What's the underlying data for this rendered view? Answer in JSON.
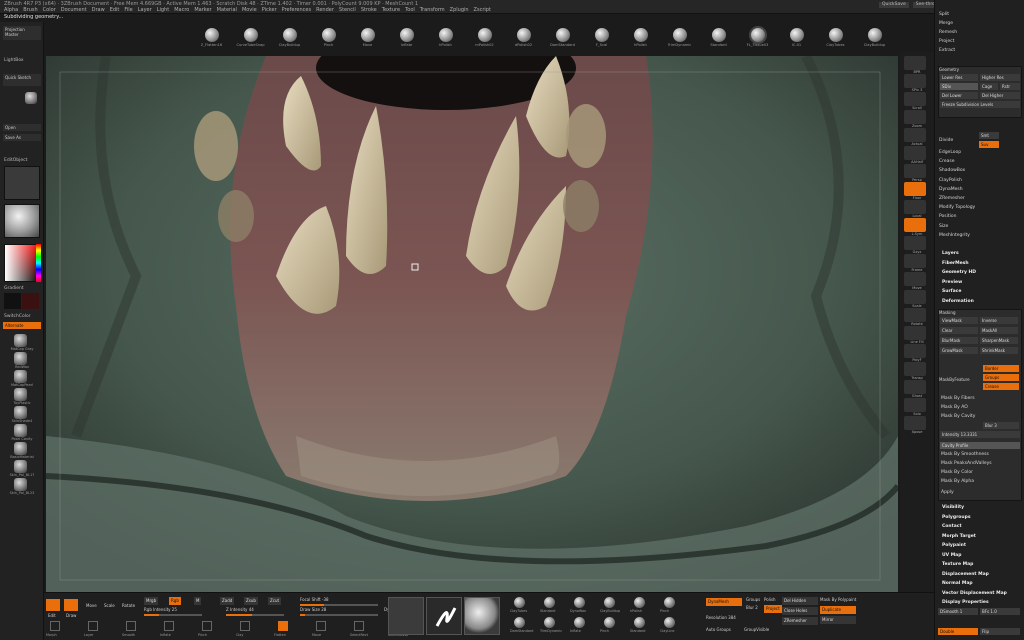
{
  "app": {
    "title": "ZBrush 4R7 P3 (x64) · 3ZBrush Document · Free Mem 4.669GB · Active Mem 1.463 · Scratch Disk 48 · ZTime 1.402 · Timer 0.001 · PolyCount 9.009 KP · MeshCount 1",
    "menus": [
      "Alpha",
      "Brush",
      "Color",
      "Document",
      "Draw",
      "Edit",
      "File",
      "Layer",
      "Light",
      "Macro",
      "Marker",
      "Material",
      "Movie",
      "Picker",
      "Preferences",
      "Render",
      "Stencil",
      "Stroke",
      "Texture",
      "Tool",
      "Transform",
      "Zplugin",
      "Zscript"
    ],
    "quicksave": "QuickSave",
    "see_through": "See-through 0",
    "menus_btn": "Menus",
    "default_script": "DefaultZScript"
  },
  "status": {
    "message": "Subdividing geometry..."
  },
  "colors": {
    "accent": "#e86f0c",
    "panel": "#222222",
    "canvas_bg": "#3b4b43"
  },
  "shelf": {
    "brushes": [
      "Z_Flatten16",
      "CurveTubeSnap",
      "ClayBuildup",
      "Pinch",
      "Move",
      "Inflate",
      "hPolish",
      "mPolish02",
      "dPolish02",
      "DamStandard",
      "F_Scal",
      "hPolish",
      "TrimDynamic",
      "Standard",
      "FL_Tissue03",
      "IC-01",
      "ClayTubes",
      "ClayBuildup"
    ],
    "selected_index": 14
  },
  "left": {
    "projection_master": "Projection Master",
    "lightbox": "LightBox",
    "quick_sketch": "Quick Sketch",
    "stereo_label": "Stereo",
    "open": "Open",
    "save_as": "Save As",
    "editobject": "EditObject",
    "gradient": "Gradient",
    "switch_color": "SwitchColor",
    "alternate": "Alternate",
    "tools": [
      "MatCap Gray",
      "RedWax",
      "MatCapPearl",
      "ToyPlastic",
      "SkinShade4",
      "Pearl Cavity",
      "BasicMaterial",
      "Skin_Pal_BL17",
      "Skin_Pal_BL23"
    ]
  },
  "right_icons": [
    "BPR",
    "SPix 3",
    "Scroll",
    "Zoom",
    "Actual",
    "AAHalf",
    "Persp",
    "Floor",
    "Local",
    "L.Sym",
    "Gxyz",
    "Frame",
    "Move",
    "Scale",
    "Rotate",
    "Line Fill",
    "PolyF",
    "Transp",
    "Ghost",
    "Solo",
    "Xpose"
  ],
  "right": {
    "top_items": [
      "Split",
      "Merge",
      "Remesh",
      "Project",
      "Extract"
    ],
    "geometry_header": "Geometry",
    "lower_res": "Lower Res",
    "higher_res": "Higher Res",
    "sdiv_label": "SDiv",
    "cage": "Cage",
    "rstr": "Rstr",
    "del_lower": "Del Lower",
    "del_higher": "Del Higher",
    "freeze_subdivision": "Freeze Subdivision Levels",
    "divide": "Divide",
    "smt": "Smt",
    "suv": "Suv",
    "geo_items": [
      "EdgeLoop",
      "Crease",
      "ShadowBox",
      "ClayPolish",
      "DynaMesh",
      "ZRemesher",
      "Modify Topology",
      "Position",
      "Size",
      "MeshIntegrity"
    ],
    "sub_menus": [
      "Layers",
      "FiberMesh",
      "Geometry HD",
      "Preview",
      "Surface",
      "Deformation"
    ],
    "masking_header": "Masking",
    "mask_buttons": [
      "ViewMask",
      "Inverse",
      "Clear",
      "MaskAll",
      "BlurMask",
      "SharpenMask",
      "GrowMask",
      "ShrinkMask"
    ],
    "mask_peaks": "MaskByFeature",
    "mask_feature_opts": [
      "Border",
      "Groups",
      "Crease"
    ],
    "mask_items": [
      "Mask By Fibers",
      "Mask By AO",
      "Mask By Cavity",
      "Mask By Smoothness",
      "Mask PeaksAndValleys",
      "Mask By Color",
      "Mask By Alpha",
      "Apply"
    ],
    "mask_by_cavity_label": "Mask By Cavity",
    "blur_label": "Blur 3",
    "intensity_label": "Intensity 13.3331",
    "cavity_profile": "Cavity Profile",
    "bottom_menus": [
      "Visibility",
      "Polygroups",
      "Contact",
      "Morph Target",
      "Polypaint",
      "UV Map",
      "Texture Map",
      "Displacement Map",
      "Normal Map",
      "Vector Displacement Map",
      "Display Properties"
    ],
    "dsmooth": "DSmooth 1",
    "bfs": "BFs 1.0",
    "double": "Double",
    "flip": "Flip"
  },
  "bottom": {
    "edit": "Edit",
    "draw": "Draw",
    "move": "Move",
    "scale": "Scale",
    "rotate": "Rotate",
    "mrgb": "Mrgb",
    "rgb": "Rgb",
    "m": "M",
    "zadd": "Zadd",
    "zsub": "Zsub",
    "zcut": "Zcut",
    "rgb_intensity": "Rgb Intensity 25",
    "z_intensity": "Z Intensity 44",
    "focal_shift": "Focal Shift -38",
    "draw_size": "Draw Size 28",
    "dynamic": "Dynamic",
    "brush_tools": [
      "Morph",
      "Layer",
      "Smooth",
      "Inflate",
      "Pinch",
      "Clay",
      "Flatten",
      "Move",
      "SelectRect",
      "SelectLasso"
    ],
    "brush_tool_states": [
      "off",
      "off",
      "off",
      "off",
      "off",
      "off",
      "on",
      "off",
      "off",
      "off"
    ],
    "texture_balls": [
      "ClayTubes",
      "Standard",
      "DynaWax",
      "ClayBuildup",
      "hPolish",
      "Pinch",
      "DamStandard",
      "TrimDynamic",
      "Inflate",
      "Pinch",
      "Standard",
      "ClayLine"
    ],
    "dynamesh": "DynaMesh",
    "groups": "Groups",
    "polish": "Polish",
    "blur": "Blur 2",
    "project": "Project",
    "resolution": "Resolution 384",
    "auto_groups": "Auto Groups",
    "group_visible": "GroupVisible",
    "del_hidden": "Del Hidden",
    "close_holes": "Close Holes",
    "zremesher_label": "ZRemesher",
    "mirror": "Mirror",
    "del_higher2": "Del Higher",
    "divide2": "Divide",
    "polypaint_from": "Mask By Polypaint",
    "duplicate": "Duplicate",
    "dup": "Dup Mesh",
    "append": "Append"
  }
}
